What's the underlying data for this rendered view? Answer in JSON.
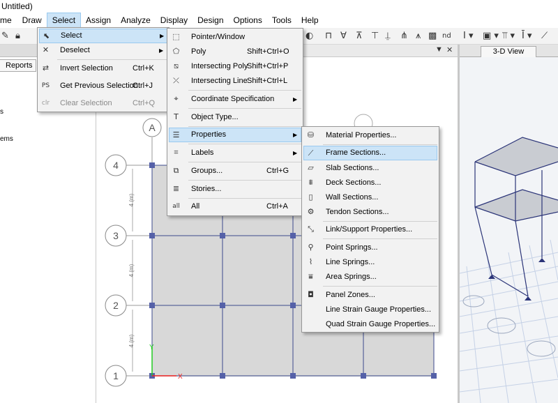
{
  "window": {
    "title": "Untitled)"
  },
  "menubar": [
    {
      "label": "me",
      "active": false
    },
    {
      "label": "Draw",
      "active": false
    },
    {
      "label": "Select",
      "active": true
    },
    {
      "label": "Assign",
      "active": false
    },
    {
      "label": "Analyze",
      "active": false
    },
    {
      "label": "Display",
      "active": false
    },
    {
      "label": "Design",
      "active": false
    },
    {
      "label": "Options",
      "active": false
    },
    {
      "label": "Tools",
      "active": false
    },
    {
      "label": "Help",
      "active": false
    }
  ],
  "left_panel": {
    "tab": "Reports",
    "fragments": [
      "s",
      "ems"
    ]
  },
  "plan_view": {
    "grid_columns": [
      "A"
    ],
    "grid_rows": [
      "4",
      "3",
      "2",
      "1"
    ],
    "spacing_labels": [
      "4 (m)",
      "4 (m)",
      "4 (m)"
    ]
  },
  "view_3d": {
    "tab": "3-D View"
  },
  "select_menu": [
    {
      "label": "Select",
      "icon": "pointer-select-icon",
      "has_submenu": true,
      "highlighted": true
    },
    {
      "label": "Deselect",
      "icon": "deselect-icon",
      "has_submenu": true
    },
    {
      "label": "Invert Selection",
      "shortcut": "Ctrl+K",
      "icon": "invert-selection-icon"
    },
    {
      "label": "Get Previous Selection",
      "shortcut": "Ctrl+J",
      "icon": "previous-selection-icon"
    },
    {
      "label": "Clear Selection",
      "shortcut": "Ctrl+Q",
      "icon": "clear-selection-icon",
      "disabled": true
    }
  ],
  "select_submenu": [
    {
      "label": "Pointer/Window",
      "icon": "pointer-window-icon"
    },
    {
      "label": "Poly",
      "shortcut": "Shift+Ctrl+O",
      "icon": "poly-icon"
    },
    {
      "label": "Intersecting Poly",
      "shortcut": "Shift+Ctrl+P",
      "icon": "intersecting-poly-icon"
    },
    {
      "label": "Intersecting Line",
      "shortcut": "Shift+Ctrl+L",
      "icon": "intersecting-line-icon"
    },
    {
      "label": "Coordinate Specification",
      "icon": "coordinate-icon",
      "has_submenu": true
    },
    {
      "label": "Object Type...",
      "icon": "object-type-icon"
    },
    {
      "label": "Properties",
      "icon": "properties-icon",
      "has_submenu": true,
      "highlighted": true
    },
    {
      "label": "Labels",
      "icon": "labels-icon",
      "has_submenu": true
    },
    {
      "label": "Groups...",
      "shortcut": "Ctrl+G",
      "icon": "groups-icon"
    },
    {
      "label": "Stories...",
      "icon": "stories-icon"
    },
    {
      "label": "All",
      "shortcut": "Ctrl+A",
      "icon": "select-all-icon"
    }
  ],
  "properties_submenu": [
    {
      "label": "Material Properties...",
      "icon": "material-icon"
    },
    {
      "label": "Frame Sections...",
      "icon": "frame-section-icon",
      "highlighted": true
    },
    {
      "label": "Slab Sections...",
      "icon": "slab-section-icon"
    },
    {
      "label": "Deck Sections...",
      "icon": "deck-section-icon"
    },
    {
      "label": "Wall Sections...",
      "icon": "wall-section-icon"
    },
    {
      "label": "Tendon Sections...",
      "icon": "tendon-section-icon"
    },
    {
      "label": "Link/Support Properties...",
      "icon": "link-support-icon"
    },
    {
      "label": "Point Springs...",
      "icon": "point-spring-icon"
    },
    {
      "label": "Line Springs...",
      "icon": "line-spring-icon"
    },
    {
      "label": "Area Springs...",
      "icon": "area-spring-icon"
    },
    {
      "label": "Panel Zones...",
      "icon": "panel-zone-icon"
    },
    {
      "label": "Line Strain Gauge Properties...",
      "icon": "line-gauge-icon"
    },
    {
      "label": "Quad Strain Gauge Properties...",
      "icon": "quad-gauge-icon"
    }
  ],
  "colors": {
    "highlight": "#cce4f7",
    "highlight_border": "#99c9ef",
    "grid_line": "#3d4a8c",
    "node": "#5561a8"
  }
}
